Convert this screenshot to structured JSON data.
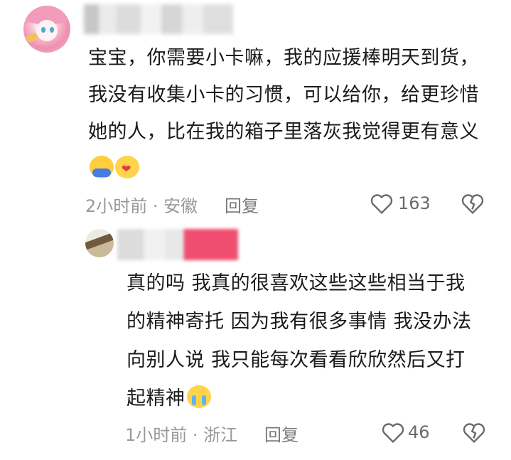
{
  "comment": {
    "text": "宝宝，你需要小卡嘛，我的应援棒明天到货，我没有收集小卡的习惯，可以给你，给更珍惜她的人，比在我的箱子里落灰我觉得更有意义",
    "meta": "2小时前 · 安徽",
    "reply_label": "回复",
    "like_count": "163",
    "emojis": [
      "hugging-face-emoji",
      "smiling-face-with-heart-emoji"
    ]
  },
  "reply": {
    "text": "真的吗 我真的很喜欢这些这些相当于我的精神寄托 因为我有很多事情 我没办法向别人说 我只能每次看看欣欣然后又打起精神",
    "meta": "1小时前 · 浙江",
    "reply_label": "回复",
    "like_count": "46",
    "emojis": [
      "crying-face-emoji"
    ]
  },
  "colors": {
    "text": "#1a1a1a",
    "meta": "#999999",
    "icon": "#6b6b6b",
    "accent_pink": "#ee3b61"
  },
  "icons": [
    "heart-outline-icon",
    "broken-heart-icon"
  ]
}
